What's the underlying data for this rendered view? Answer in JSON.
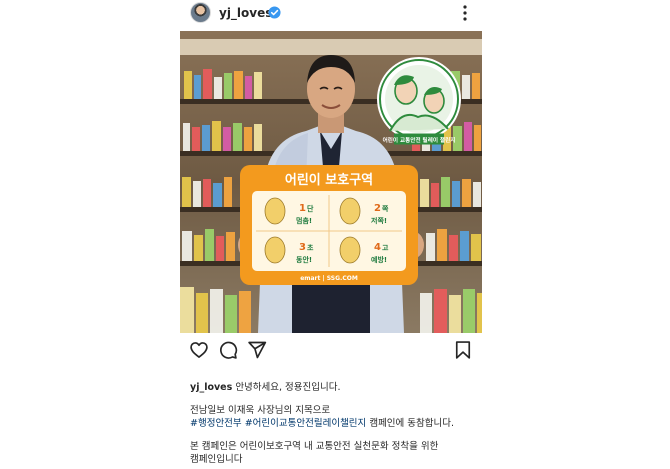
{
  "post": {
    "username": "yj_loves",
    "verified": true,
    "icons": {
      "more": "more-vertical-icon",
      "like": "heart-icon",
      "comment": "comment-icon",
      "share": "share-icon",
      "save": "bookmark-icon"
    },
    "image": {
      "sign_title": "어린이 보호구역",
      "sign_cells": [
        {
          "num": "1",
          "line1": "단",
          "line2": "멈춤!"
        },
        {
          "num": "2",
          "line1": "쪽",
          "line2": "저쪽!"
        },
        {
          "num": "3",
          "line1": "초",
          "line2": "동안!"
        },
        {
          "num": "4",
          "line1": "고",
          "line2": "예방!"
        }
      ],
      "sign_brand": "emart | SSG.COM",
      "badge_text": "어린이 교통안전 릴레이 챌린지"
    },
    "caption": {
      "greeting": "안녕하세요, 정용진입니다.",
      "line2": "전남일보 이재욱 사장님의 지목으로",
      "hashtag1": "#행정안전부",
      "hashtag2": "#어린이교통안전릴레이챌린지",
      "line3_suffix": "캠페인에 동참합니다.",
      "line4": "본 캠페인은 어린이보호구역 내 교통안전 실천문화 정착을 위한",
      "line5": "캠페인입니다"
    }
  },
  "colors": {
    "verified": "#3897f0",
    "hashtag": "#00376b",
    "sign_orange": "#f39a1e",
    "badge_green": "#2e8b3d"
  }
}
